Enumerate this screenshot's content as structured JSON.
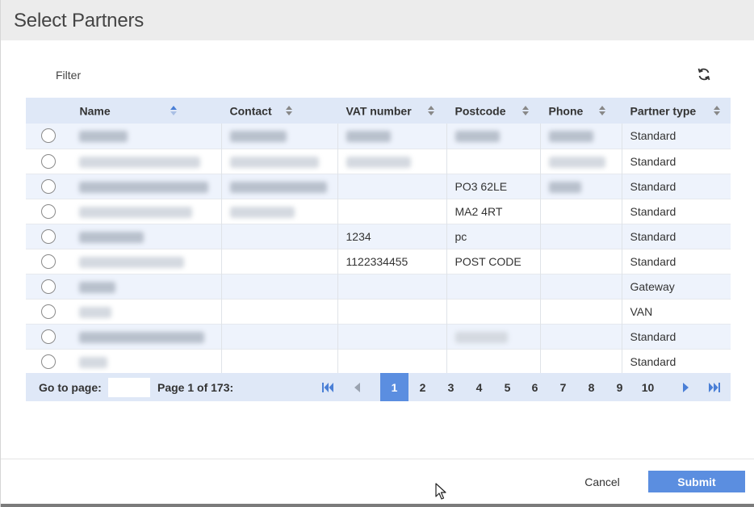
{
  "dialog": {
    "title": "Select Partners"
  },
  "toolbar": {
    "filter_label": "Filter",
    "refresh_icon": "refresh-icon"
  },
  "table": {
    "columns": [
      "Name",
      "Contact",
      "VAT number",
      "Postcode",
      "Phone",
      "Partner type"
    ],
    "rows": [
      {
        "name": "",
        "contact": "",
        "vat": "",
        "postcode": "",
        "phone": "",
        "type": "Standard"
      },
      {
        "name": "",
        "contact": "",
        "vat": "",
        "postcode": "",
        "phone": "",
        "type": "Standard"
      },
      {
        "name": "",
        "contact": "",
        "vat": "",
        "postcode": "PO3 62LE",
        "phone": "",
        "type": "Standard"
      },
      {
        "name": "",
        "contact": "",
        "vat": "",
        "postcode": "MA2 4RT",
        "phone": "",
        "type": "Standard"
      },
      {
        "name": "",
        "contact": "",
        "vat": "1234",
        "postcode": "pc",
        "phone": "",
        "type": "Standard"
      },
      {
        "name": "",
        "contact": "",
        "vat": "1122334455",
        "postcode": "POST CODE",
        "phone": "",
        "type": "Standard"
      },
      {
        "name": "",
        "contact": "",
        "vat": "",
        "postcode": "",
        "phone": "",
        "type": "Gateway"
      },
      {
        "name": "",
        "contact": "",
        "vat": "",
        "postcode": "",
        "phone": "",
        "type": "VAN"
      },
      {
        "name": "",
        "contact": "",
        "vat": "",
        "postcode": "",
        "phone": "",
        "type": "Standard"
      },
      {
        "name": "",
        "contact": "",
        "vat": "",
        "postcode": "",
        "phone": "",
        "type": "Standard"
      }
    ]
  },
  "pager": {
    "goto_label": "Go to page:",
    "goto_value": "",
    "page_info": "Page 1 of 173:",
    "pages": [
      "1",
      "2",
      "3",
      "4",
      "5",
      "6",
      "7",
      "8",
      "9",
      "10"
    ],
    "current_page": "1"
  },
  "footer": {
    "cancel_label": "Cancel",
    "submit_label": "Submit"
  },
  "colors": {
    "accent": "#5b8ee0",
    "header_bg": "#dfe8f7",
    "row_alt": "#eef3fc",
    "title_bar": "#ececec"
  }
}
